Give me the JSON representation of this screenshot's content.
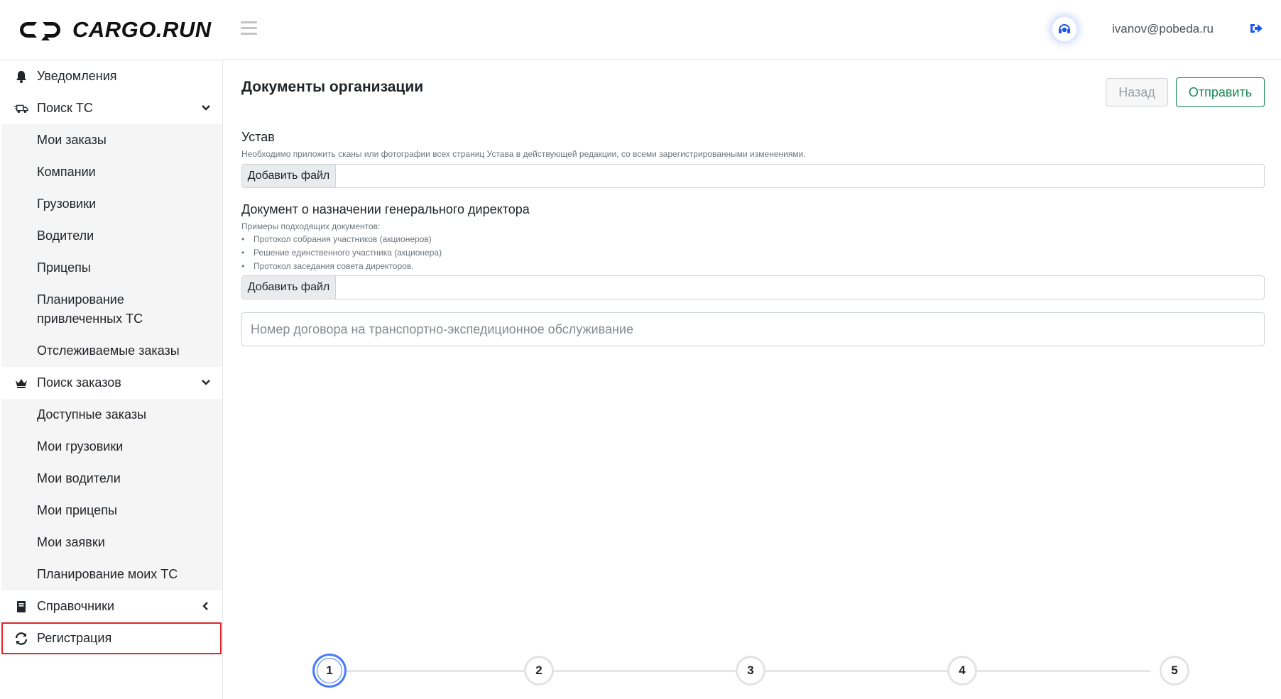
{
  "brand": {
    "name": "CARGO.RUN"
  },
  "header": {
    "user_email": "ivanov@pobeda.ru",
    "support_icon": "headset-icon",
    "logout_icon": "sign-out-icon",
    "menu_icon": "hamburger-icon"
  },
  "sidebar": {
    "items": [
      {
        "label": "Уведомления",
        "icon": "bell-icon"
      },
      {
        "label": "Поиск ТС",
        "icon": "truck-icon",
        "expanded": true
      },
      {
        "label": "Поиск заказов",
        "icon": "crown-icon",
        "expanded": true
      },
      {
        "label": "Справочники",
        "icon": "book-icon",
        "expanded": false
      },
      {
        "label": "Регистрация",
        "icon": "sync-icon",
        "active": true
      }
    ],
    "search_vehicles_sub": [
      "Мои заказы",
      "Компании",
      "Грузовики",
      "Водители",
      "Прицепы",
      "Планирование привлеченных ТС",
      "Отслеживаемые заказы"
    ],
    "search_orders_sub": [
      "Доступные заказы",
      "Мои грузовики",
      "Мои водители",
      "Мои прицепы",
      "Мои заявки",
      "Планирование моих ТС"
    ]
  },
  "main": {
    "title": "Документы организации",
    "back_label": "Назад",
    "send_label": "Отправить",
    "charter": {
      "title": "Устав",
      "hint": "Необходимо приложить сканы или фотографии всех страниц Устава в действующей редакции, со всеми зарегистрированными изменениями.",
      "add_file": "Добавить файл"
    },
    "director": {
      "title": "Документ о назначении генерального директора",
      "hint": "Примеры подходящих документов:",
      "examples": [
        "Протокол собрания участников (акционеров)",
        "Решение единственного участника (акционера)",
        "Протокол заседания совета директоров."
      ],
      "add_file": "Добавить файл"
    },
    "contract": {
      "placeholder": "Номер договора на транспортно-экспедиционное обслуживание"
    }
  },
  "stepper": {
    "steps": [
      "1",
      "2",
      "3",
      "4",
      "5"
    ],
    "current": 1,
    "accent": "#4a7cf7"
  },
  "colors": {
    "success": "#198754",
    "active_outline": "#e0262b"
  }
}
